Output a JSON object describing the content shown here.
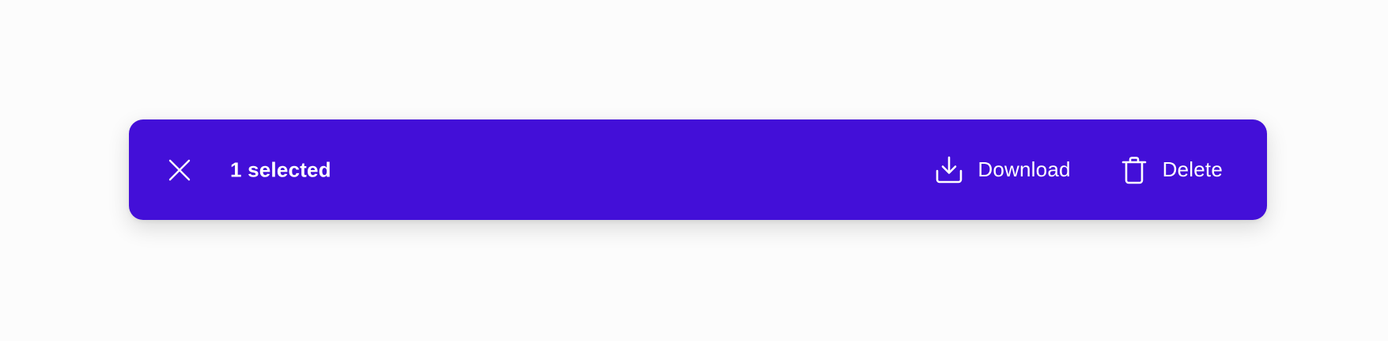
{
  "selection_bar": {
    "background_color": "#430fd8",
    "text_color": "#ffffff",
    "close_icon": "close-icon",
    "count_text": "1 selected",
    "actions": [
      {
        "label": "Download",
        "icon": "download-icon"
      },
      {
        "label": "Delete",
        "icon": "trash-icon"
      }
    ]
  }
}
